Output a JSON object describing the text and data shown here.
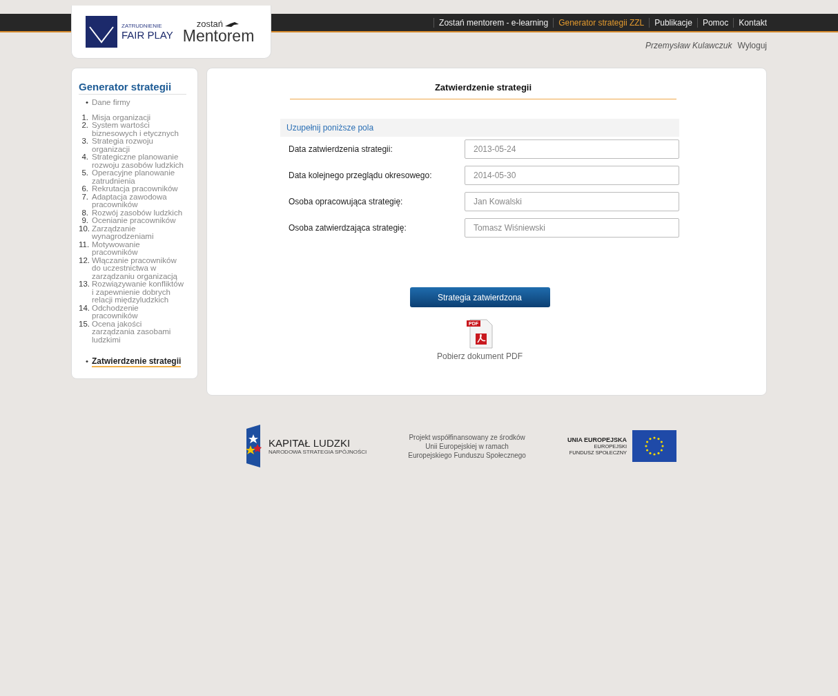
{
  "logo": {
    "small": "ZATRUDNIENIE",
    "big": "FAIR PLAY",
    "mentor_small": "zostań",
    "mentor_big": "Mentorem"
  },
  "nav": [
    {
      "label": "Zostań mentorem - e-learning",
      "selected": false
    },
    {
      "label": "Generator strategii ZZL",
      "selected": true
    },
    {
      "label": "Publikacje",
      "selected": false
    },
    {
      "label": "Pomoc",
      "selected": false
    },
    {
      "label": "Kontakt",
      "selected": false
    }
  ],
  "user": {
    "name": "Przemysław Kulawczuk",
    "logout": "Wyloguj"
  },
  "sidebar": {
    "title": "Generator strategii",
    "items": [
      {
        "marker": "•",
        "label": "Dane firmy",
        "selected": false
      },
      {
        "marker": "1.",
        "label": "Misja organizacji",
        "selected": false
      },
      {
        "marker": "2.",
        "label": "System wartości biznesowych i etycznych",
        "selected": false
      },
      {
        "marker": "3.",
        "label": "Strategia rozwoju organizacji",
        "selected": false
      },
      {
        "marker": "4.",
        "label": "Strategiczne planowanie rozwoju zasobów ludzkich",
        "selected": false
      },
      {
        "marker": "5.",
        "label": "Operacyjne planowanie zatrudnienia",
        "selected": false
      },
      {
        "marker": "6.",
        "label": "Rekrutacja pracowników",
        "selected": false
      },
      {
        "marker": "7.",
        "label": "Adaptacja zawodowa pracowników",
        "selected": false
      },
      {
        "marker": "8.",
        "label": "Rozwój zasobów ludzkich",
        "selected": false
      },
      {
        "marker": "9.",
        "label": "Ocenianie pracowników",
        "selected": false
      },
      {
        "marker": "10.",
        "label": "Zarządzanie wynagrodzeniami",
        "selected": false
      },
      {
        "marker": "11.",
        "label": "Motywowanie pracowników",
        "selected": false
      },
      {
        "marker": "12.",
        "label": "Włączanie pracowników do uczestnictwa w zarządzaniu organizacją",
        "selected": false
      },
      {
        "marker": "13.",
        "label": "Rozwiązywanie konfliktów i zapewnienie dobrych relacji międzyludzkich",
        "selected": false
      },
      {
        "marker": "14.",
        "label": "Odchodzenie pracowników",
        "selected": false
      },
      {
        "marker": "15.",
        "label": "Ocena jakości zarządzania zasobami ludzkimi",
        "selected": false
      },
      {
        "marker": "•",
        "label": "Zatwierdzenie strategii",
        "selected": true
      }
    ]
  },
  "main": {
    "title": "Zatwierdzenie strategii",
    "section": "Uzupełnij poniższe pola",
    "fields": [
      {
        "label": "Data zatwierdzenia strategii:",
        "value": "2013-05-24"
      },
      {
        "label": "Data kolejnego przeglądu okresowego:",
        "value": "2014-05-30"
      },
      {
        "label": "Osoba opracowująca strategię:",
        "value": "Jan Kowalski"
      },
      {
        "label": "Osoba zatwierdzająca strategię:",
        "value": "Tomasz Wiśniewski"
      }
    ],
    "button": "Strategia zatwierdzona",
    "pdf_badge": "PDF",
    "pdf_link": "Pobierz dokument PDF"
  },
  "footer": {
    "kl_title": "KAPITAŁ LUDZKI",
    "kl_sub": "NARODOWA STRATEGIA SPÓJNOŚCI",
    "project": [
      "Projekt współfinansowany ze środków",
      "Unii Europejskiej w ramach",
      "Europejskiego Funduszu Społecznego"
    ],
    "eu_title": "UNIA EUROPEJSKA",
    "eu_sub1": "EUROPEJSKI",
    "eu_sub2": "FUNDUSZ SPOŁECZNY"
  }
}
